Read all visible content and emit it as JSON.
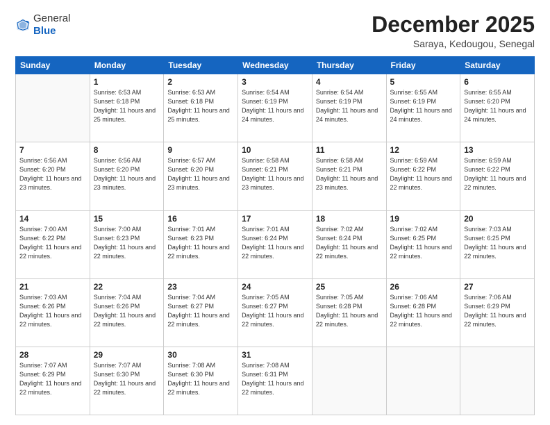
{
  "header": {
    "logo_line1": "General",
    "logo_line2": "Blue",
    "title": "December 2025",
    "subtitle": "Saraya, Kedougou, Senegal"
  },
  "calendar": {
    "headers": [
      "Sunday",
      "Monday",
      "Tuesday",
      "Wednesday",
      "Thursday",
      "Friday",
      "Saturday"
    ],
    "rows": [
      [
        {
          "day": "",
          "content": ""
        },
        {
          "day": "1",
          "content": "Sunrise: 6:53 AM\nSunset: 6:18 PM\nDaylight: 11 hours and 25 minutes."
        },
        {
          "day": "2",
          "content": "Sunrise: 6:53 AM\nSunset: 6:18 PM\nDaylight: 11 hours and 25 minutes."
        },
        {
          "day": "3",
          "content": "Sunrise: 6:54 AM\nSunset: 6:19 PM\nDaylight: 11 hours and 24 minutes."
        },
        {
          "day": "4",
          "content": "Sunrise: 6:54 AM\nSunset: 6:19 PM\nDaylight: 11 hours and 24 minutes."
        },
        {
          "day": "5",
          "content": "Sunrise: 6:55 AM\nSunset: 6:19 PM\nDaylight: 11 hours and 24 minutes."
        },
        {
          "day": "6",
          "content": "Sunrise: 6:55 AM\nSunset: 6:20 PM\nDaylight: 11 hours and 24 minutes."
        }
      ],
      [
        {
          "day": "7",
          "content": "Sunrise: 6:56 AM\nSunset: 6:20 PM\nDaylight: 11 hours and 23 minutes."
        },
        {
          "day": "8",
          "content": "Sunrise: 6:56 AM\nSunset: 6:20 PM\nDaylight: 11 hours and 23 minutes."
        },
        {
          "day": "9",
          "content": "Sunrise: 6:57 AM\nSunset: 6:20 PM\nDaylight: 11 hours and 23 minutes."
        },
        {
          "day": "10",
          "content": "Sunrise: 6:58 AM\nSunset: 6:21 PM\nDaylight: 11 hours and 23 minutes."
        },
        {
          "day": "11",
          "content": "Sunrise: 6:58 AM\nSunset: 6:21 PM\nDaylight: 11 hours and 23 minutes."
        },
        {
          "day": "12",
          "content": "Sunrise: 6:59 AM\nSunset: 6:22 PM\nDaylight: 11 hours and 22 minutes."
        },
        {
          "day": "13",
          "content": "Sunrise: 6:59 AM\nSunset: 6:22 PM\nDaylight: 11 hours and 22 minutes."
        }
      ],
      [
        {
          "day": "14",
          "content": "Sunrise: 7:00 AM\nSunset: 6:22 PM\nDaylight: 11 hours and 22 minutes."
        },
        {
          "day": "15",
          "content": "Sunrise: 7:00 AM\nSunset: 6:23 PM\nDaylight: 11 hours and 22 minutes."
        },
        {
          "day": "16",
          "content": "Sunrise: 7:01 AM\nSunset: 6:23 PM\nDaylight: 11 hours and 22 minutes."
        },
        {
          "day": "17",
          "content": "Sunrise: 7:01 AM\nSunset: 6:24 PM\nDaylight: 11 hours and 22 minutes."
        },
        {
          "day": "18",
          "content": "Sunrise: 7:02 AM\nSunset: 6:24 PM\nDaylight: 11 hours and 22 minutes."
        },
        {
          "day": "19",
          "content": "Sunrise: 7:02 AM\nSunset: 6:25 PM\nDaylight: 11 hours and 22 minutes."
        },
        {
          "day": "20",
          "content": "Sunrise: 7:03 AM\nSunset: 6:25 PM\nDaylight: 11 hours and 22 minutes."
        }
      ],
      [
        {
          "day": "21",
          "content": "Sunrise: 7:03 AM\nSunset: 6:26 PM\nDaylight: 11 hours and 22 minutes."
        },
        {
          "day": "22",
          "content": "Sunrise: 7:04 AM\nSunset: 6:26 PM\nDaylight: 11 hours and 22 minutes."
        },
        {
          "day": "23",
          "content": "Sunrise: 7:04 AM\nSunset: 6:27 PM\nDaylight: 11 hours and 22 minutes."
        },
        {
          "day": "24",
          "content": "Sunrise: 7:05 AM\nSunset: 6:27 PM\nDaylight: 11 hours and 22 minutes."
        },
        {
          "day": "25",
          "content": "Sunrise: 7:05 AM\nSunset: 6:28 PM\nDaylight: 11 hours and 22 minutes."
        },
        {
          "day": "26",
          "content": "Sunrise: 7:06 AM\nSunset: 6:28 PM\nDaylight: 11 hours and 22 minutes."
        },
        {
          "day": "27",
          "content": "Sunrise: 7:06 AM\nSunset: 6:29 PM\nDaylight: 11 hours and 22 minutes."
        }
      ],
      [
        {
          "day": "28",
          "content": "Sunrise: 7:07 AM\nSunset: 6:29 PM\nDaylight: 11 hours and 22 minutes."
        },
        {
          "day": "29",
          "content": "Sunrise: 7:07 AM\nSunset: 6:30 PM\nDaylight: 11 hours and 22 minutes."
        },
        {
          "day": "30",
          "content": "Sunrise: 7:08 AM\nSunset: 6:30 PM\nDaylight: 11 hours and 22 minutes."
        },
        {
          "day": "31",
          "content": "Sunrise: 7:08 AM\nSunset: 6:31 PM\nDaylight: 11 hours and 22 minutes."
        },
        {
          "day": "",
          "content": ""
        },
        {
          "day": "",
          "content": ""
        },
        {
          "day": "",
          "content": ""
        }
      ]
    ]
  }
}
